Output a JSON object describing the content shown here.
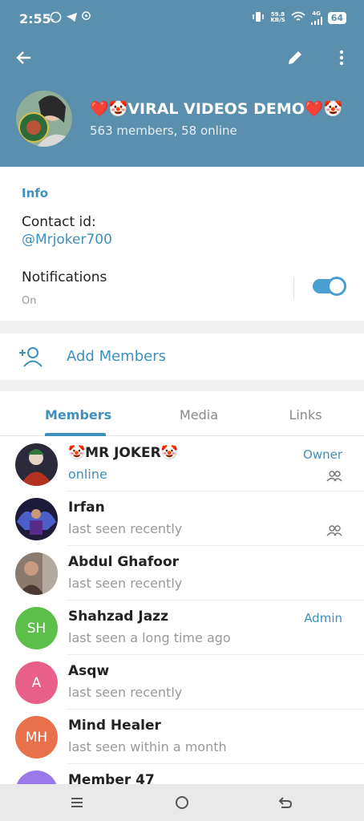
{
  "status_bar": {
    "time": "2:55",
    "speed_value": "59.8",
    "speed_unit": "KB/S",
    "network": "4G",
    "battery": "64"
  },
  "header": {
    "title": "❤️🤡VIRAL VIDEOS DEMO❤️🤡",
    "subtitle": "563 members, 58 online"
  },
  "info": {
    "section_label": "Info",
    "contact_label": "Contact id:",
    "contact_value": "@Mrjoker700",
    "notifications_label": "Notifications",
    "notifications_state": "On",
    "notifications_enabled": true
  },
  "add_members": {
    "label": "Add Members"
  },
  "tabs": [
    {
      "label": "Members",
      "active": true
    },
    {
      "label": "Media",
      "active": false
    },
    {
      "label": "Links",
      "active": false
    }
  ],
  "members": [
    {
      "name": "🤡MR JOKER🤡",
      "status": "online",
      "role": "Owner",
      "initials": "",
      "color": "#7a2a1f"
    },
    {
      "name": "Irfan",
      "status": "last seen recently",
      "role": "",
      "initials": "",
      "color": "#3a2a5a"
    },
    {
      "name": "Abdul Ghafoor",
      "status": "last seen recently",
      "role": "",
      "initials": "",
      "color": "#6a5a52"
    },
    {
      "name": "Shahzad Jazz",
      "status": "last seen a long time ago",
      "role": "Admin",
      "initials": "SH",
      "color": "#5bbf4a"
    },
    {
      "name": "Asqw",
      "status": "last seen recently",
      "role": "",
      "initials": "A",
      "color": "#e8608a"
    },
    {
      "name": "Mind Healer",
      "status": "last seen within a month",
      "role": "",
      "initials": "MH",
      "color": "#e8704a"
    },
    {
      "name": "Member 47",
      "status": "",
      "role": "",
      "initials": "",
      "color": "#9a7ae8"
    }
  ],
  "colors": {
    "header": "#5a8fad",
    "accent": "#3f8fbf"
  }
}
